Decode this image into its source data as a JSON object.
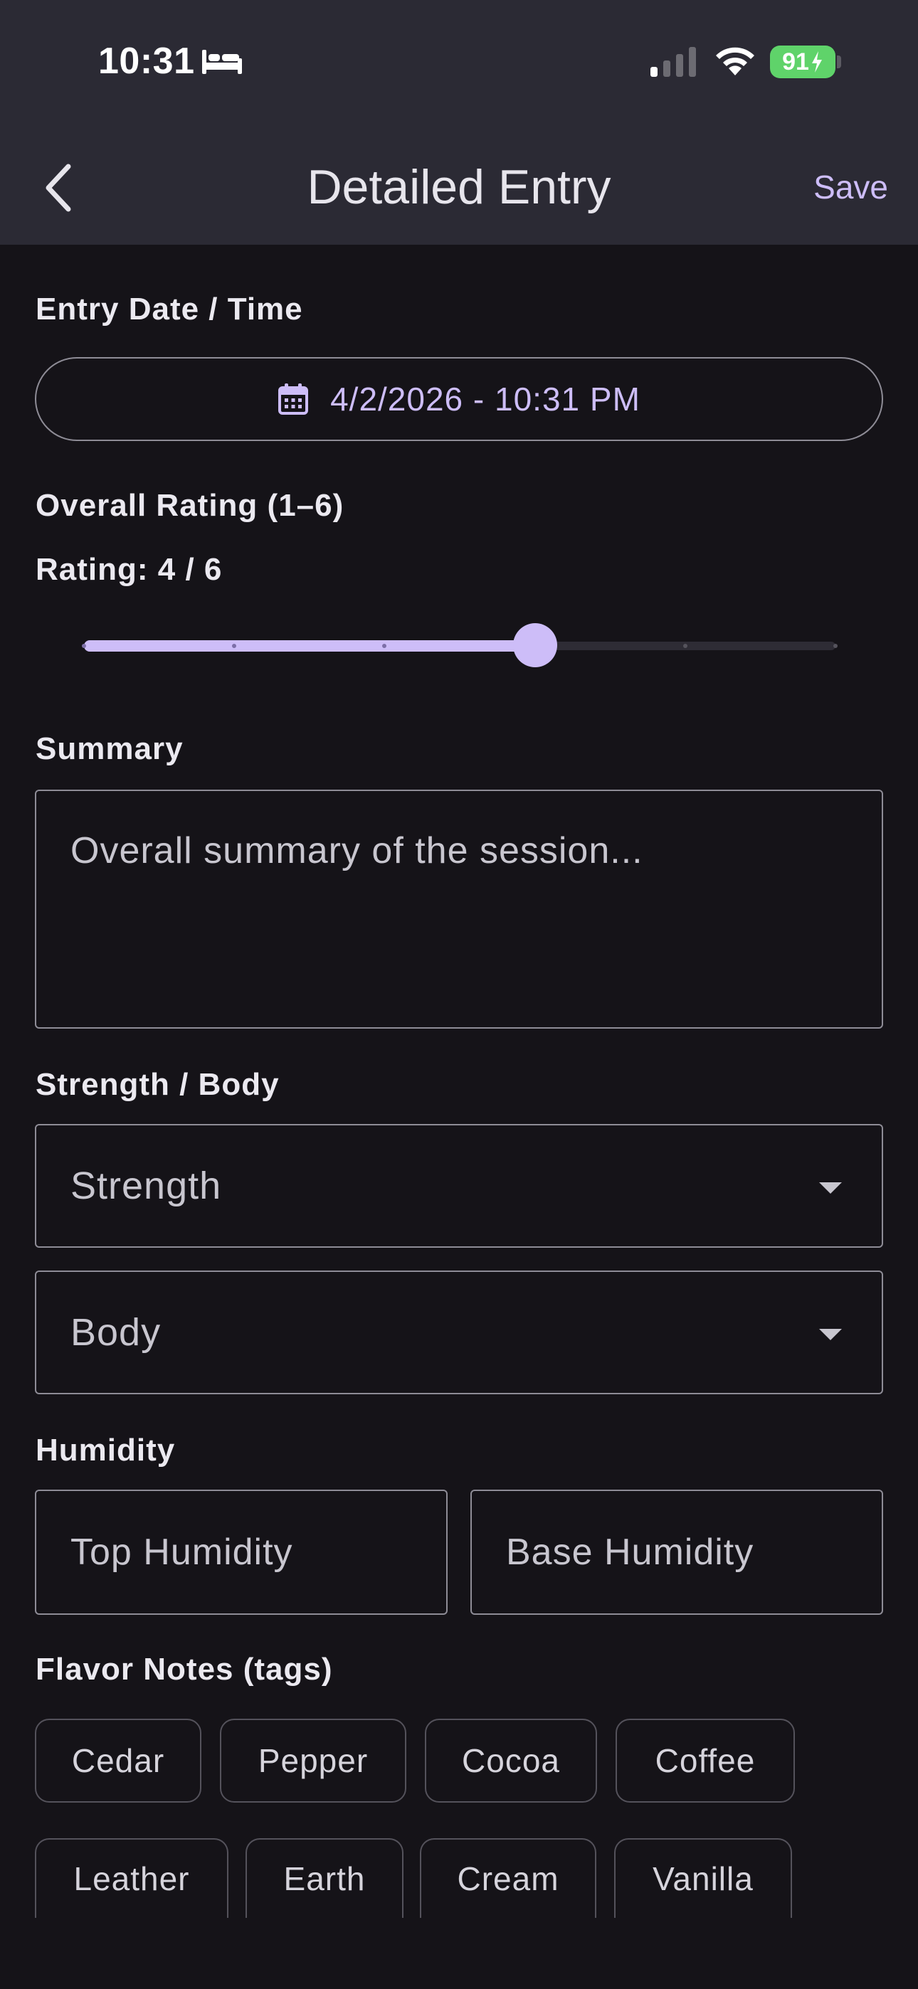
{
  "status_bar": {
    "time": "10:31",
    "sleep_icon": "bed-icon",
    "battery": "91"
  },
  "nav": {
    "title": "Detailed Entry",
    "save_label": "Save",
    "back_icon": "chevron-left-icon"
  },
  "entry_date": {
    "label": "Entry Date / Time",
    "value": "4/2/2026 - 10:31 PM",
    "icon": "calendar-icon"
  },
  "rating": {
    "label": "Overall Rating (1–6)",
    "value_text": "Rating: 4 / 6",
    "value": 4,
    "min": 1,
    "max": 6
  },
  "summary": {
    "label": "Summary",
    "placeholder": "Overall summary of the session..."
  },
  "strength_body": {
    "label": "Strength / Body",
    "strength_placeholder": "Strength",
    "body_placeholder": "Body"
  },
  "humidity": {
    "label": "Humidity",
    "top_placeholder": "Top Humidity",
    "base_placeholder": "Base Humidity"
  },
  "flavor_notes": {
    "label": "Flavor Notes (tags)",
    "tags": [
      "Cedar",
      "Pepper",
      "Cocoa",
      "Coffee",
      "Leather",
      "Earth",
      "Cream",
      "Vanilla"
    ]
  },
  "colors": {
    "accent": "#cdbdf8",
    "background": "#151318",
    "header": "#2b2a34",
    "outline": "#8e8c96",
    "battery": "#5fd36a"
  }
}
